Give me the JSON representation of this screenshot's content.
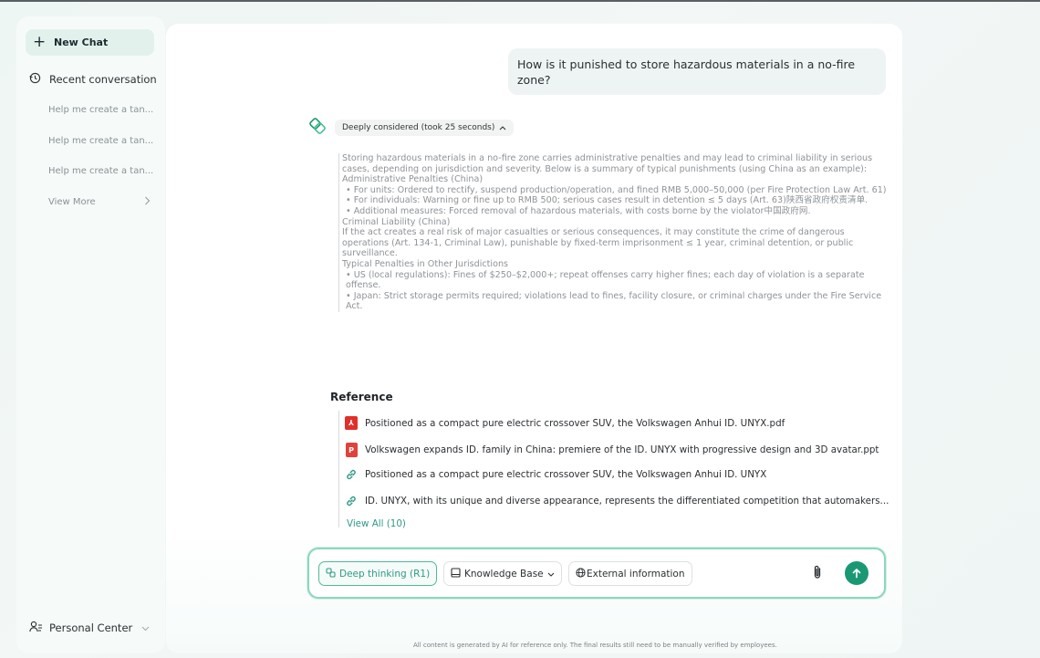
{
  "sidebar": {
    "new_chat_label": "New Chat",
    "recent_label": "Recent conversation",
    "history": [
      "Help me create a tan...",
      "Help me create a tan...",
      "Help me create a tan..."
    ],
    "view_more_label": "View More",
    "personal_center_label": "Personal Center"
  },
  "chat": {
    "user_message": "How is it punished to store hazardous materials in a no-fire zone?",
    "thinking_label": "Deeply considered (took 25 seconds)",
    "reasoning": {
      "intro": "Storing hazardous materials in a no-fire zone carries administrative penalties and may lead to criminal liability in serious cases, depending on jurisdiction and severity. Below is a summary of typical punishments (using China as an example):",
      "admin_heading": "Administrative Penalties (China)",
      "admin_1": "• For units: Ordered to rectify, suspend production/operation, and fined RMB 5,000–50,000 (per Fire Protection Law Art. 61)",
      "admin_2": "• For individuals: Warning or fine up to RMB 500; serious cases result in detention ≤ 5 days (Art. 63)陕西省政府权责清单.",
      "admin_3": "• Additional measures: Forced removal of hazardous materials, with costs borne by the violator中国政府网.",
      "criminal_heading": "Criminal Liability (China)",
      "criminal_text": "If the act creates a real risk of major casualties or serious consequences, it may constitute the crime of dangerous operations (Art. 134-1, Criminal Law), punishable by fixed-term imprisonment ≤ 1 year, criminal detention, or public surveillance.",
      "other_heading": "Typical Penalties in Other Jurisdictions",
      "other_1": "• US (local regulations): Fines of $250–$2,000+; repeat offenses carry higher fines; each day of violation is a separate offense.",
      "other_2": "• Japan: Strict storage permits required; violations lead to fines, facility closure, or criminal charges under the Fire Service Act."
    },
    "reference_title": "Reference",
    "references": [
      {
        "type": "pdf",
        "text": "Positioned as a compact pure electric crossover SUV, the Volkswagen Anhui ID. UNYX.pdf"
      },
      {
        "type": "ppt",
        "text": "Volkswagen expands ID. family in China: premiere of the ID. UNYX with progressive design and 3D avatar.ppt"
      },
      {
        "type": "link",
        "text": "Positioned as a compact pure electric crossover SUV, the Volkswagen Anhui ID. UNYX"
      },
      {
        "type": "link",
        "text": "ID. UNYX, with its unique and diverse appearance, represents the differentiated competition that automakers..."
      }
    ],
    "view_all_label": "View All (10)"
  },
  "input": {
    "deep_thinking_label": "Deep thinking (R1)",
    "knowledge_base_label": "Knowledge Base",
    "external_label": "External information"
  },
  "footer_note": "All content is generated by AI for reference only. The final results still need to be manually verified by employees.",
  "colors": {
    "accent": "#1a9873",
    "accent_light": "#8bd7bd",
    "pdf": "#e0302b"
  }
}
